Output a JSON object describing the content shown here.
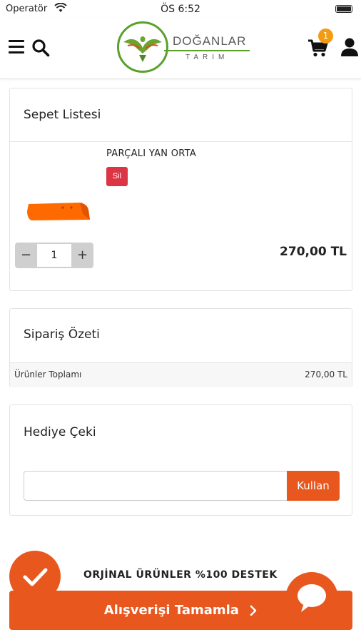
{
  "status_bar": {
    "carrier": "Operatör",
    "time": "ÖS 6:52"
  },
  "header": {
    "logo": {
      "name": "DOĞANLAR",
      "subtitle": "TARIM"
    },
    "cart_count": "1",
    "icons": [
      "menu-icon",
      "search-icon",
      "cart-icon",
      "user-icon"
    ]
  },
  "cart": {
    "title": "Sepet Listesi",
    "items": [
      {
        "name": "PARÇALI YAN ORTA",
        "delete_label": "Sil",
        "quantity": "1",
        "minus": "−",
        "plus": "+",
        "price": "270,00 TL"
      }
    ]
  },
  "summary": {
    "title": "Sipariş Özeti",
    "rows": [
      {
        "label": "Ürünler Toplamı",
        "value": "270,00 TL"
      }
    ]
  },
  "gift": {
    "title": "Hediye Çeki",
    "input_placeholder": "",
    "button_label": "Kullan"
  },
  "features": [
    {
      "text": "ORJİNAL ÜRÜNLER %100 DESTEK",
      "icon": "check-icon"
    }
  ],
  "checkout": {
    "label": "Alışverişi Tamamla"
  },
  "colors": {
    "accent": "#e8581e",
    "danger": "#dc3545",
    "badge": "#f39c12",
    "brand_green": "#5aa02c",
    "product_orange": "#ff6a00"
  }
}
